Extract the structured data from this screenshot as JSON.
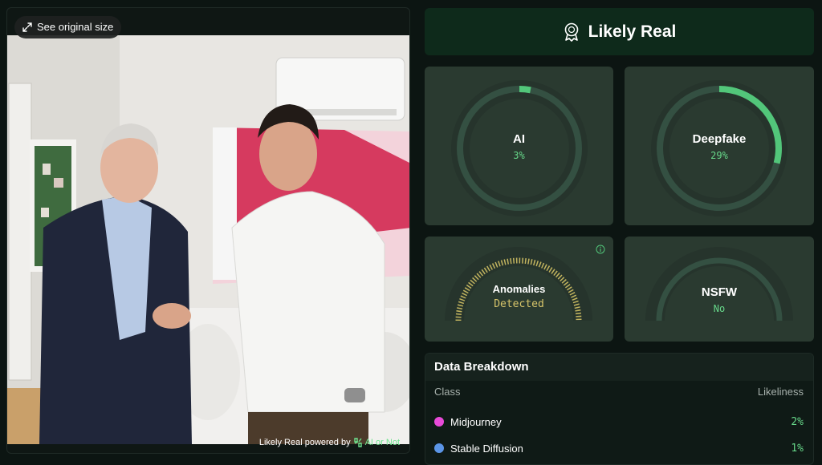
{
  "image_panel": {
    "original_size_label": "See original size",
    "powered_by": {
      "prefix": "Likely Real powered by",
      "brand": "AI or Not"
    }
  },
  "verdict": {
    "label": "Likely Real",
    "icon": "award-badge-icon"
  },
  "scores": {
    "ai": {
      "title": "AI",
      "value": "3%",
      "level": 0.03
    },
    "deepfake": {
      "title": "Deepfake",
      "value": "29%",
      "level": 0.29
    },
    "anomalies": {
      "title": "Anomalies",
      "value": "Detected",
      "level": 1.0
    },
    "nsfw": {
      "title": "NSFW",
      "value": "No",
      "level": 0.0
    }
  },
  "breakdown": {
    "title": "Data Breakdown",
    "col_class": "Class",
    "col_likeliness": "Likeliness",
    "rows": [
      {
        "name": "Midjourney",
        "value": "2%",
        "color": "#e84ad8"
      },
      {
        "name": "Stable Diffusion",
        "value": "1%",
        "color": "#5b95e6"
      }
    ]
  },
  "colors": {
    "accent_green": "#67d88a",
    "warning_yellow": "#d6c46a",
    "card_bg": "#2a3a30",
    "verdict_bg": "#0e2a1b"
  }
}
